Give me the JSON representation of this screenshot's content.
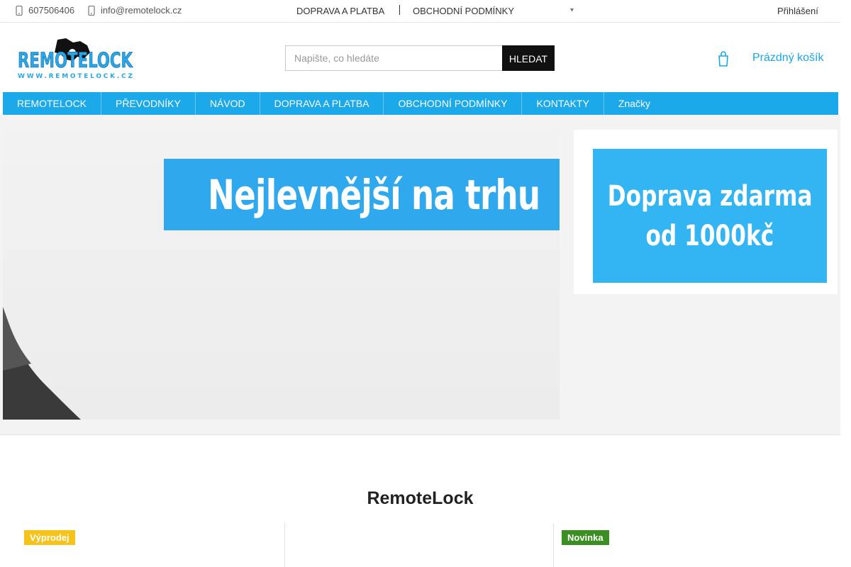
{
  "topbar": {
    "phone": "607506406",
    "email": "info@remotelock.cz",
    "links": [
      "DOPRAVA A PLATBA",
      "OBCHODNÍ PODMÍNKY"
    ],
    "login": "Přihlášení"
  },
  "header": {
    "logo_text": "REMOTELOCK",
    "logo_url_text": "WWW.REMOTELOCK.CZ",
    "search": {
      "placeholder": "Napište, co hledáte",
      "value": "",
      "button": "HLEDAT"
    },
    "cart_label": "Prázdný košík"
  },
  "nav": {
    "items": [
      "REMOTELOCK",
      "PŘEVODNÍKY",
      "NÁVOD",
      "DOPRAVA A PLATBA",
      "OBCHODNÍ PODMÍNKY",
      "KONTAKTY",
      "Značky"
    ]
  },
  "banners": {
    "main_text": "Nejlevnější na trhu",
    "side_line1": "Doprava zdarma",
    "side_line2": "od 1000kč"
  },
  "section": {
    "title": "RemoteLock",
    "flags": [
      "Výprodej",
      "Novinka"
    ]
  },
  "colors": {
    "accent": "#1ba9ea",
    "banner_blue": "#2fa8ee",
    "sale": "#f6c31a",
    "new": "#3a8e22"
  }
}
